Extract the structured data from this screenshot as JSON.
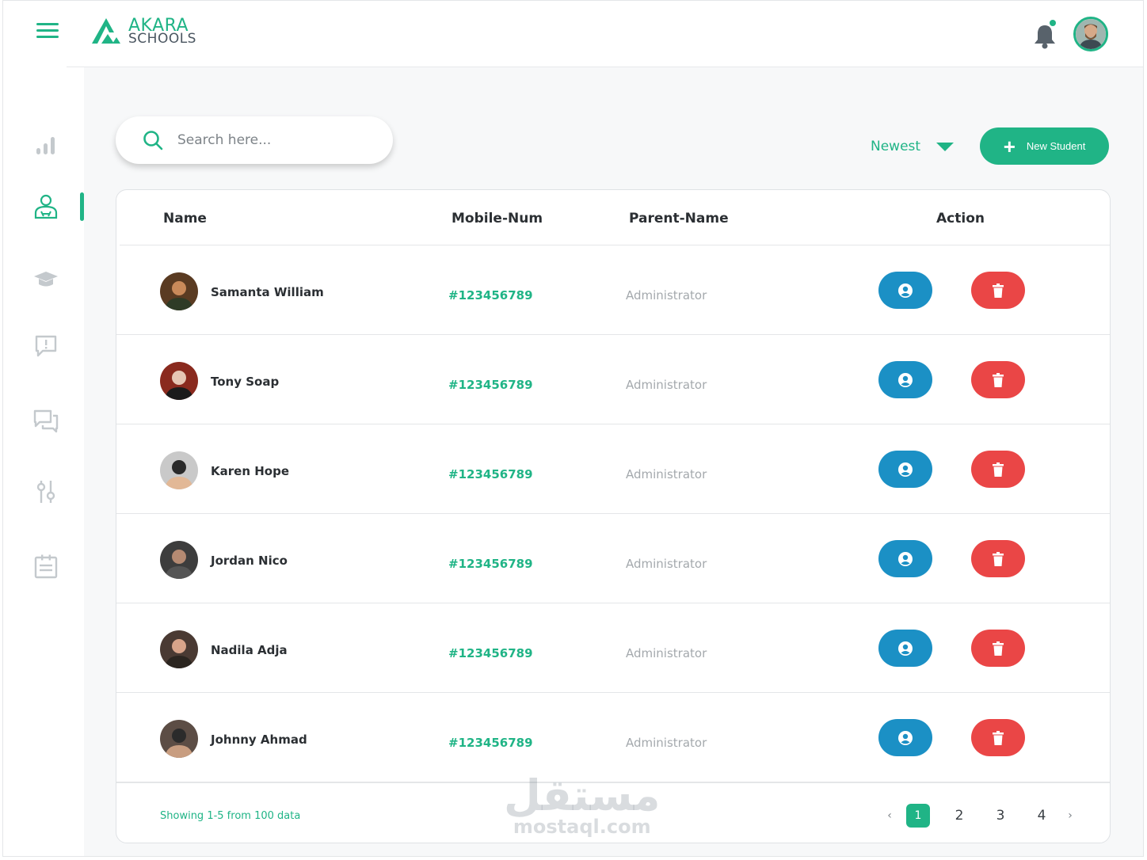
{
  "brand": {
    "line1": "AKARA",
    "line2": "SCHOOLS"
  },
  "colors": {
    "accent": "#20b486",
    "view": "#1b90c5",
    "delete": "#ea4646",
    "muted": "#a4a9ad"
  },
  "sidebar": {
    "items": [
      {
        "icon": "bar-chart-icon"
      },
      {
        "icon": "student-icon",
        "active": true
      },
      {
        "icon": "graduation-cap-icon"
      },
      {
        "icon": "alert-message-icon"
      },
      {
        "icon": "chat-icon"
      },
      {
        "icon": "sliders-icon"
      },
      {
        "icon": "clipboard-icon"
      }
    ]
  },
  "search": {
    "placeholder": "Search here..."
  },
  "sort": {
    "label": "Newest"
  },
  "actions": {
    "new_student": "New Student"
  },
  "table": {
    "headers": {
      "name": "Name",
      "mobile": "Mobile-Num",
      "parent": "Parent-Name",
      "action": "Action"
    },
    "rows": [
      {
        "name": "Samanta William",
        "mobile": "#123456789",
        "parent": "Administrator"
      },
      {
        "name": "Tony Soap",
        "mobile": "#123456789",
        "parent": "Administrator"
      },
      {
        "name": "Karen Hope",
        "mobile": "#123456789",
        "parent": "Administrator"
      },
      {
        "name": "Jordan Nico",
        "mobile": "#123456789",
        "parent": "Administrator"
      },
      {
        "name": "Nadila Adja",
        "mobile": "#123456789",
        "parent": "Administrator"
      },
      {
        "name": "Johnny Ahmad",
        "mobile": "#123456789",
        "parent": "Administrator"
      }
    ]
  },
  "footer": {
    "showing": "Showing 1-5 from 100 data"
  },
  "pagination": {
    "pages": [
      "1",
      "2",
      "3",
      "4"
    ],
    "current": "1",
    "prev": "‹",
    "next": "›"
  },
  "watermark": {
    "arabic": "مستقل",
    "latin": "mostaql.com"
  }
}
